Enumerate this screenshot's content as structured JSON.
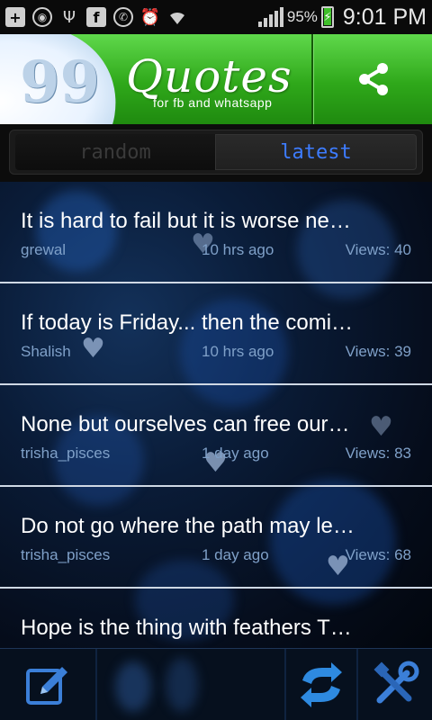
{
  "status_bar": {
    "battery_percent": "95%",
    "time": "9:01 PM",
    "icons": [
      "add-icon",
      "target-icon",
      "usb-icon",
      "facebook-icon",
      "whatsapp-icon",
      "alarm-icon",
      "wifi-icon",
      "signal-icon",
      "battery-icon"
    ]
  },
  "header": {
    "quote_mark": "99",
    "logo_title": "Quotes",
    "logo_subtitle": "for fb and whatsapp"
  },
  "tabs": {
    "random": "random",
    "latest": "latest",
    "selected": "latest"
  },
  "quotes": [
    {
      "text": "It is hard to fail but it is worse ne…",
      "author": "grewal",
      "time": "10 hrs ago",
      "views": "Views: 40"
    },
    {
      "text": "If today is Friday... then the comi…",
      "author": "Shalish",
      "time": "10 hrs ago",
      "views": "Views: 39"
    },
    {
      "text": "None but ourselves can free our…",
      "author": "trisha_pisces",
      "time": "1 day ago",
      "views": "Views: 83"
    },
    {
      "text": "Do not go where the path may le…",
      "author": "trisha_pisces",
      "time": "1 day ago",
      "views": "Views: 68"
    },
    {
      "text": "Hope is the thing with feathers T…",
      "author": "",
      "time": "",
      "views": ""
    }
  ],
  "colors": {
    "header_green": "#2fa81a",
    "accent_blue": "#3d7cff",
    "meta_blue": "#7fa0c8"
  }
}
